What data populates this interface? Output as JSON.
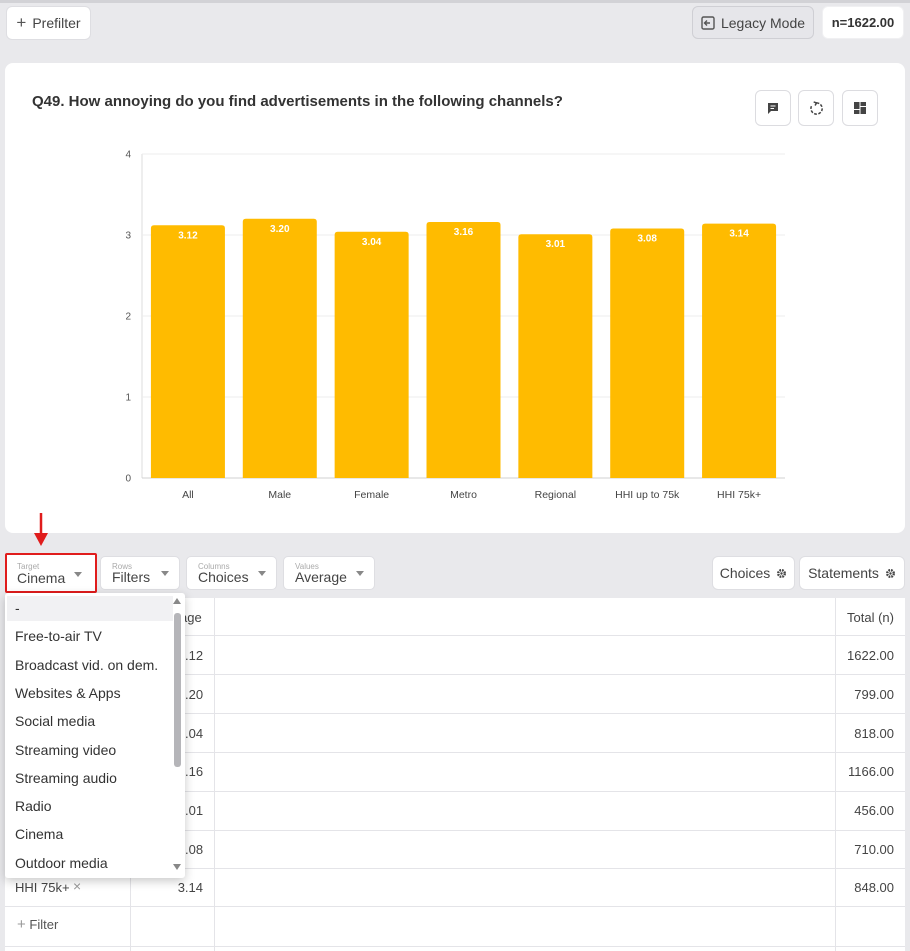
{
  "toolbar": {
    "prefilter_label": "Prefilter",
    "legacy_mode_label": "Legacy Mode",
    "sample_size": "n=1622.00"
  },
  "question": {
    "title": "Q49. How annoying do you find advertisements in the following channels?"
  },
  "chart_data": {
    "type": "bar",
    "categories": [
      "All",
      "Male",
      "Female",
      "Metro",
      "Regional",
      "HHI up to 75k",
      "HHI 75k+"
    ],
    "values": [
      3.12,
      3.2,
      3.04,
      3.16,
      3.01,
      3.08,
      3.14
    ],
    "value_labels": [
      "3.12",
      "3.20",
      "3.04",
      "3.16",
      "3.01",
      "3.08",
      "3.14"
    ],
    "yticks": [
      "0",
      "1",
      "2",
      "3",
      "4"
    ],
    "ylim": [
      0,
      4
    ],
    "bar_color": "#ffbb00",
    "grid": true
  },
  "selectors": {
    "target": {
      "small": "Target",
      "value": "Cinema"
    },
    "rows": {
      "small": "Rows",
      "value": "Filters"
    },
    "columns": {
      "small": "Columns",
      "value": "Choices"
    },
    "values": {
      "small": "Values",
      "value": "Average"
    },
    "choices_btn": "Choices",
    "statements_btn": "Statements"
  },
  "table": {
    "header_col2_fragment": "age",
    "header_total": "Total (n)",
    "rows": [
      {
        "avg": ".12",
        "total": "1622.00"
      },
      {
        "avg": ".20",
        "total": "799.00"
      },
      {
        "avg": ".04",
        "total": "818.00"
      },
      {
        "avg": ".16",
        "total": "1166.00"
      },
      {
        "avg": ".01",
        "total": "456.00"
      },
      {
        "avg": ".08",
        "total": "710.00"
      },
      {
        "label": "HHI 75k+",
        "avg": "3.14",
        "total": "848.00"
      }
    ],
    "add_filter_label": "Filter"
  },
  "dropdown": {
    "items": [
      "-",
      "Free-to-air TV",
      "Broadcast vid. on dem.",
      "Websites & Apps",
      "Social media",
      "Streaming video",
      "Streaming audio",
      "Radio",
      "Cinema",
      "Outdoor media"
    ]
  },
  "colors": {
    "highlight_box": "#e01c1c",
    "arrow": "#e01c1c"
  }
}
